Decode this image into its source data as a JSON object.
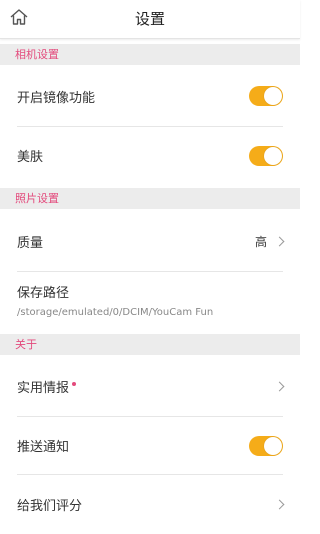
{
  "header": {
    "title": "设置",
    "home_icon": "home-icon"
  },
  "sections": {
    "camera": {
      "title": "相机设置"
    },
    "photo": {
      "title": "照片设置"
    },
    "about": {
      "title": "关于"
    }
  },
  "camera_settings": {
    "mirror_label": "开启镜像功能",
    "mirror_on": true,
    "beauty_label": "美肤",
    "beauty_on": true
  },
  "photo_settings": {
    "quality_label": "质量",
    "quality_value": "高",
    "save_path_label": "保存路径",
    "save_path_value": "/storage/emulated/0/DCIM/YouCam Fun"
  },
  "about": {
    "tips_label": "实用情报",
    "tips_has_new": true,
    "push_label": "推送通知",
    "push_on": true,
    "rate_label": "给我们评分"
  },
  "colors": {
    "accent_toggle": "#f5ac19",
    "section_title": "#e34a7c",
    "section_bg": "#ececec"
  }
}
